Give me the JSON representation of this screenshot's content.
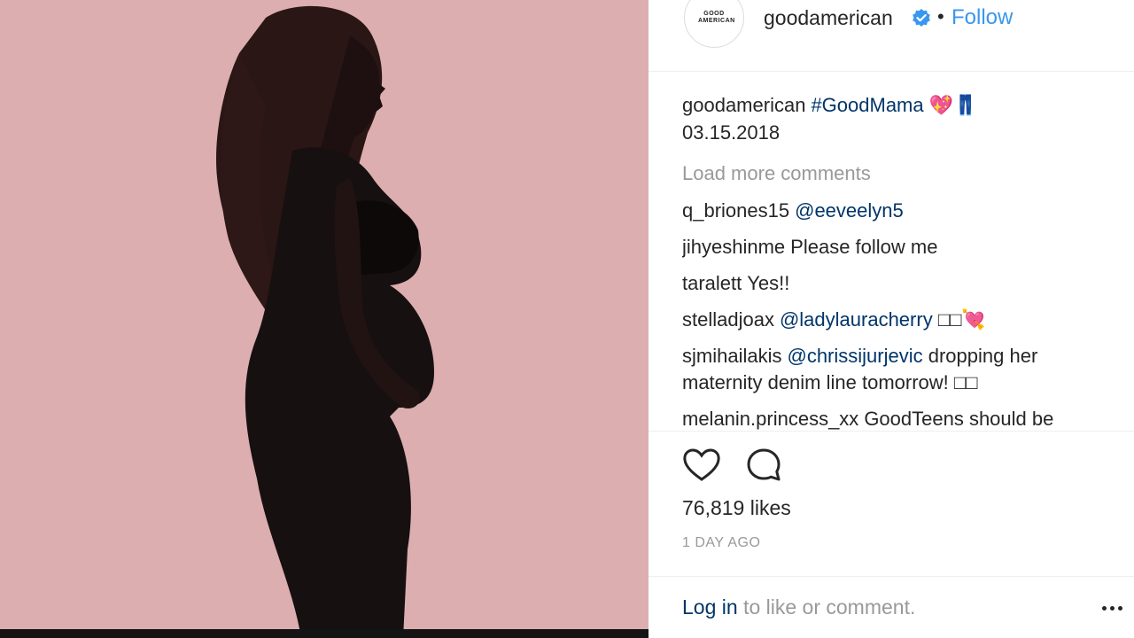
{
  "post": {
    "image_alt_icon": "silhouette-photo"
  },
  "header": {
    "avatar_text": "GOOD\nAMERICAN",
    "username": "goodamerican",
    "separator": "•",
    "follow_label": "Follow"
  },
  "caption": {
    "username": "goodamerican",
    "hashtag": "#GoodMama",
    "emoji": "💖👖",
    "date": "03.15.2018"
  },
  "load_more_label": "Load more comments",
  "comments": [
    {
      "user": "q_briones15",
      "mention": "@eeveelyn5",
      "text": ""
    },
    {
      "user": "jihyeshinme",
      "mention": "",
      "text": "Please follow me"
    },
    {
      "user": "taralett",
      "mention": "",
      "text": "Yes!!"
    },
    {
      "user": "stelladjoax",
      "mention": "@ladylauracherry",
      "text": "□□💘"
    },
    {
      "user": "sjmihailakis",
      "mention": "@chrissijurjevic",
      "text": "dropping her maternity denim line tomorrow! □□"
    },
    {
      "user": "melanin.princess_xx",
      "mention": "",
      "text": "GoodTeens should be"
    }
  ],
  "actions": {
    "like_icon": "heart-icon",
    "comment_icon": "comment-icon"
  },
  "likes": "76,819 likes",
  "time_ago": "1 DAY AGO",
  "footer": {
    "login_link": "Log in",
    "login_rest": " to like or comment.",
    "more_icon": "more-options-icon"
  },
  "colors": {
    "photo_bg": "#dcaeb0",
    "link": "#003569",
    "follow": "#3897f0",
    "muted": "#999999"
  }
}
